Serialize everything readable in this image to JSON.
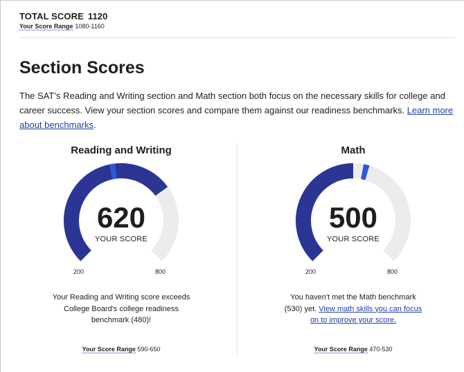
{
  "total": {
    "label": "TOTAL SCORE",
    "score": "1120",
    "range_label": "Your Score Range",
    "range_value": "1080-1160"
  },
  "section": {
    "title": "Section Scores",
    "description": "The SAT’s Reading and Writing section and Math section both focus on the necessary skills for college and career success. View your section scores and compare them against our readiness benchmarks.",
    "link": "Learn more about benchmarks",
    "link_suffix": "."
  },
  "reading": {
    "title": "Reading and Writing",
    "score": "620",
    "score_label": "YOUR SCORE",
    "min": "200",
    "max": "800",
    "benchmark": 480,
    "message": "Your Reading and Writing score exceeds College Board's college readiness benchmark (480)!",
    "range_label": "Your Score Range",
    "range_value": "590-650"
  },
  "math": {
    "title": "Math",
    "score": "500",
    "score_label": "YOUR SCORE",
    "min": "200",
    "max": "800",
    "benchmark": 530,
    "message_prefix": "You haven't met the Math benchmark (530) yet.",
    "link": "View math skills you can focus on to improve your score.",
    "range_label": "Your Score Range",
    "range_value": "470-530"
  },
  "colors": {
    "fill": "#2a3594",
    "marker": "#2f57d6",
    "track": "#ececec",
    "link": "#1f3fa8"
  }
}
